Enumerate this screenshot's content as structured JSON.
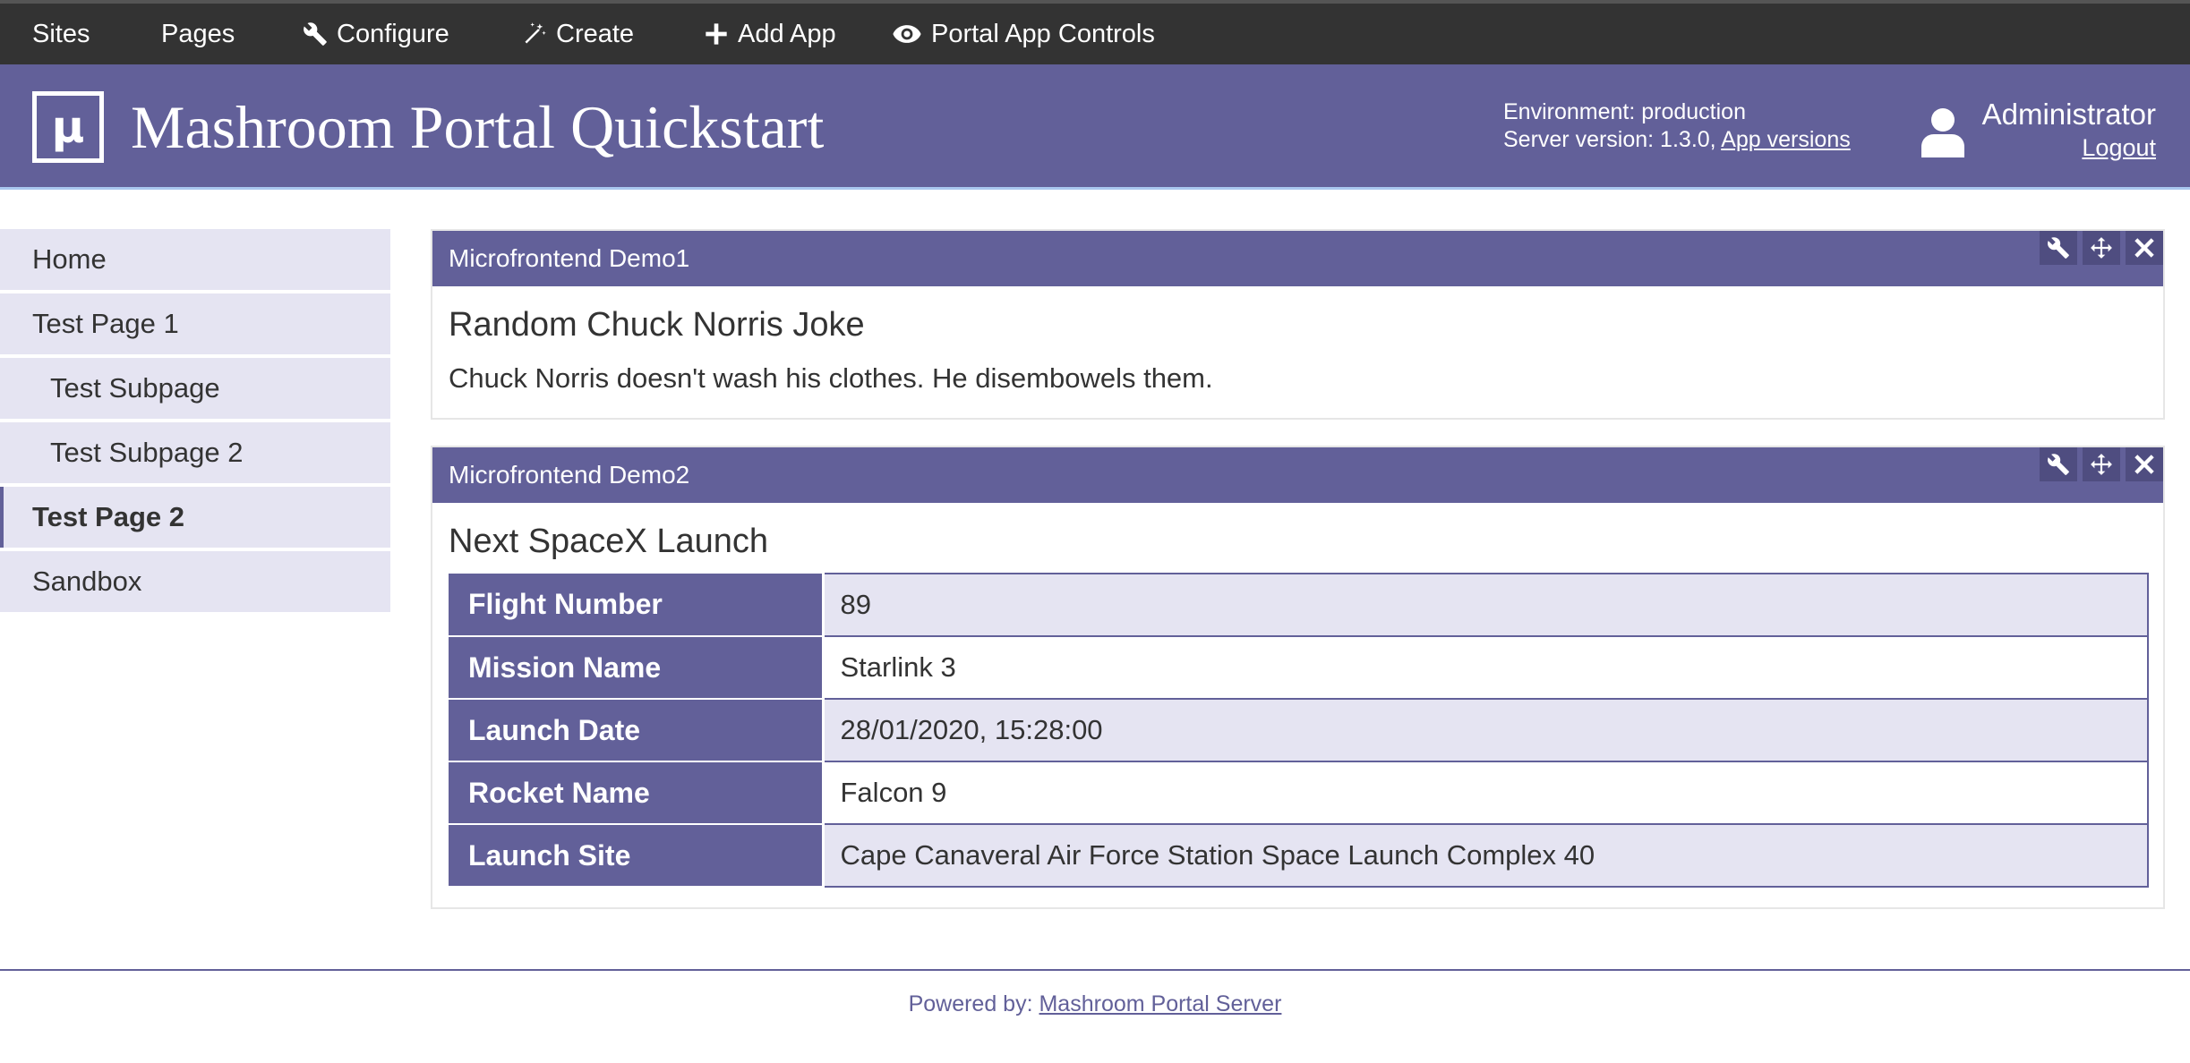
{
  "topbar": {
    "sites": "Sites",
    "pages": "Pages",
    "configure": "Configure",
    "create": "Create",
    "add_app": "Add App",
    "portal_app_controls": "Portal App Controls"
  },
  "header": {
    "title": "Mashroom Portal Quickstart",
    "environment": "Environment: production",
    "server_version": "Server version: 1.3.0,",
    "app_versions_link": "App versions",
    "user_name": "Administrator",
    "logout": "Logout"
  },
  "sidebar": {
    "items": [
      {
        "label": "Home"
      },
      {
        "label": "Test Page 1"
      },
      {
        "label": "Test Subpage"
      },
      {
        "label": "Test Subpage 2"
      },
      {
        "label": "Test Page 2"
      },
      {
        "label": "Sandbox"
      }
    ]
  },
  "apps": [
    {
      "title": "Microfrontend Demo1",
      "heading": "Random Chuck Norris Joke",
      "text": "Chuck Norris doesn't wash his clothes. He disembowels them."
    },
    {
      "title": "Microfrontend Demo2",
      "heading": "Next SpaceX Launch",
      "rows": [
        {
          "label": "Flight Number",
          "value": "89"
        },
        {
          "label": "Mission Name",
          "value": "Starlink 3"
        },
        {
          "label": "Launch Date",
          "value": "28/01/2020, 15:28:00"
        },
        {
          "label": "Rocket Name",
          "value": "Falcon 9"
        },
        {
          "label": "Launch Site",
          "value": "Cape Canaveral Air Force Station Space Launch Complex 40"
        }
      ]
    }
  ],
  "footer": {
    "prefix": "Powered by:",
    "link": "Mashroom Portal Server"
  },
  "colors": {
    "brand": "#626099",
    "nav_bg": "#e5e4f2",
    "topbar_bg": "#333333"
  },
  "icons": {
    "logo": "mashroom-logo-icon",
    "configure": "wrench-icon",
    "create": "magic-wand-icon",
    "add_app": "plus-icon",
    "controls": "eye-icon",
    "user": "user-icon",
    "app_configure": "wrench-icon",
    "app_move": "move-icon",
    "app_close": "close-icon"
  }
}
